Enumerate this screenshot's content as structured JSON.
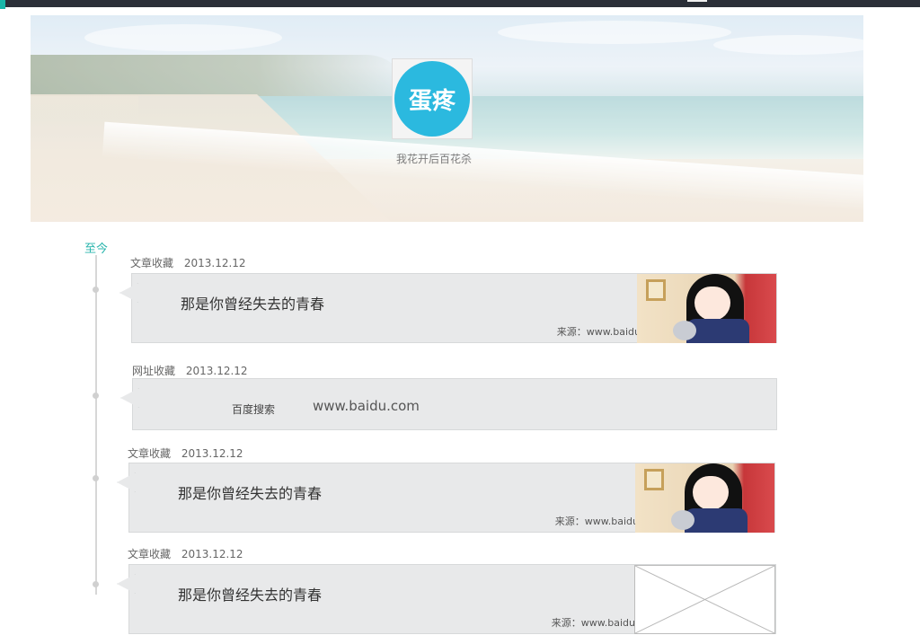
{
  "header": {
    "tagline": "我花开后百花杀",
    "logo_text": "蛋疼"
  },
  "timeline": {
    "label": "至今",
    "items": [
      {
        "category": "文章收藏",
        "date": "2013.12.12",
        "title": "那是你曾经失去的青春",
        "source": "来源：www.baidu.com",
        "thumbnail": "anime-girl-image"
      },
      {
        "category": "网址收藏",
        "date": "2013.12.12",
        "link_label": "百度搜索",
        "url": "www.baidu.com"
      },
      {
        "category": "文章收藏",
        "date": "2013.12.12",
        "title": "那是你曾经失去的青春",
        "source": "来源：www.baidu.com",
        "thumbnail": "anime-girl-image"
      },
      {
        "category": "文章收藏",
        "date": "2013.12.12",
        "title": "那是你曾经失去的青春",
        "source": "来源：www.baidu",
        "thumbnail": "image-placeholder"
      }
    ]
  },
  "colors": {
    "accent": "#2ab5ad",
    "card_bg": "#e8e9ea",
    "logo_blue": "#2bb9df"
  }
}
